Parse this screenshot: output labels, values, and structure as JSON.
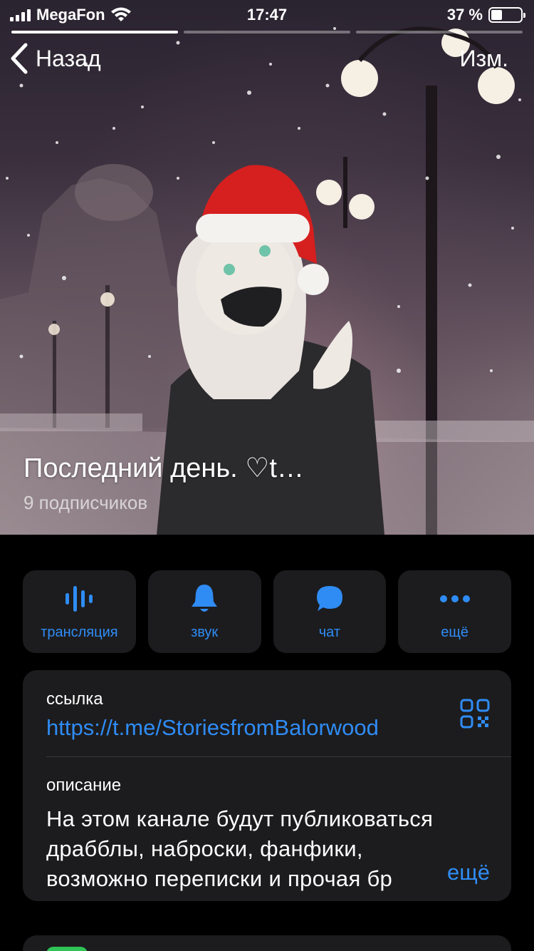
{
  "status_bar": {
    "carrier": "MegaFon",
    "time": "17:47",
    "battery_text": "37 %",
    "battery_level": 0.37
  },
  "story": {
    "segments": 3,
    "active": 0
  },
  "nav": {
    "back_label": "Назад",
    "edit_label": "Изм."
  },
  "channel": {
    "title": "Последний день. ♡t…",
    "subscribers": "9 подписчиков"
  },
  "actions": [
    {
      "label": "трансляция",
      "icon": "waveform-icon"
    },
    {
      "label": "звук",
      "icon": "bell-icon"
    },
    {
      "label": "чат",
      "icon": "chat-bubble-icon"
    },
    {
      "label": "ещё",
      "icon": "more-dots-icon"
    }
  ],
  "info": {
    "link_label": "ссылка",
    "link_value": "https://t.me/StoriesfromBalorwood",
    "qr_icon": "qr-code-icon",
    "description_label": "описание",
    "description_lines": [
      "На этом канале будут публиковаться",
      "драбблы, наброски, фанфики,",
      "возможно переписки и прочая бр"
    ],
    "more_label": "ещё"
  },
  "colors": {
    "accent": "#2f8cf5",
    "card_bg": "#1c1c1e",
    "page_bg": "#000000",
    "badge_green": "#30c356"
  }
}
